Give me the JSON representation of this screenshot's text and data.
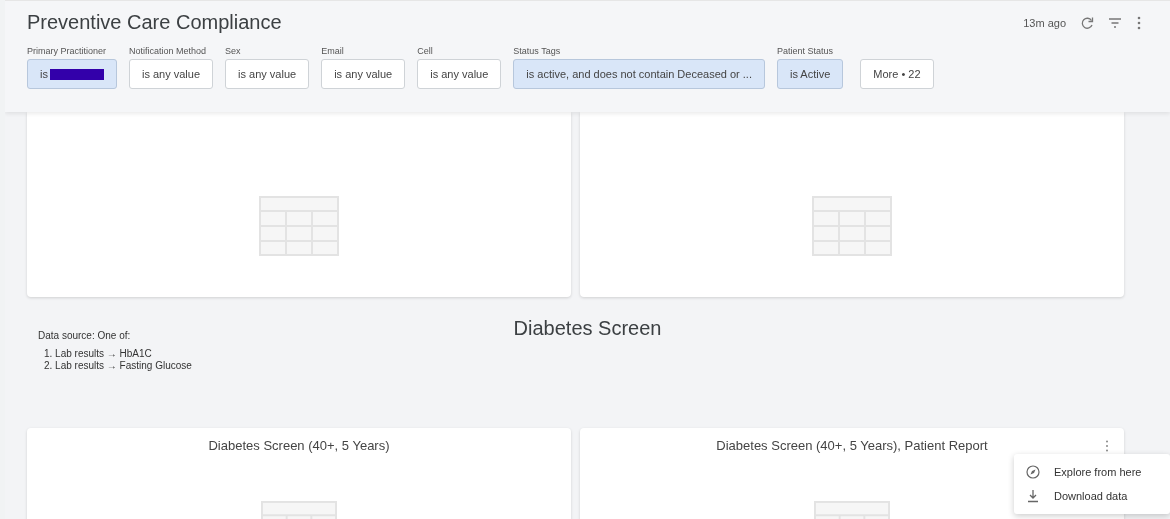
{
  "dashboard": {
    "title": "Preventive Care Compliance",
    "updated": "13m ago"
  },
  "filters": [
    {
      "label": "Primary Practitioner",
      "value": "is",
      "active": true,
      "redacted": true
    },
    {
      "label": "Notification Method",
      "value": "is any value",
      "active": false,
      "redacted": false
    },
    {
      "label": "Sex",
      "value": "is any value",
      "active": false,
      "redacted": false
    },
    {
      "label": "Email",
      "value": "is any value",
      "active": false,
      "redacted": false
    },
    {
      "label": "Cell",
      "value": "is any value",
      "active": false,
      "redacted": false
    },
    {
      "label": "Status Tags",
      "value": "is active, and does not contain Deceased or ...",
      "active": true,
      "redacted": false
    },
    {
      "label": "Patient Status",
      "value": "is Active",
      "active": true,
      "redacted": false
    }
  ],
  "more_button": "More • 22",
  "section": {
    "title": "Diabetes Screen",
    "source": "Data source: One of:",
    "items": [
      "1. Lab results → HbA1C",
      "2. Lab results → Fasting Glucose"
    ]
  },
  "tiles": [
    {
      "title": "Diabetes Screen (40+, 5 Years)",
      "menu": false
    },
    {
      "title": "Diabetes Screen (40+, 5 Years), Patient Report",
      "menu": true
    }
  ],
  "tile_menu": [
    {
      "kind": "explore",
      "label": "Explore from here"
    },
    {
      "kind": "download",
      "label": "Download data"
    }
  ]
}
